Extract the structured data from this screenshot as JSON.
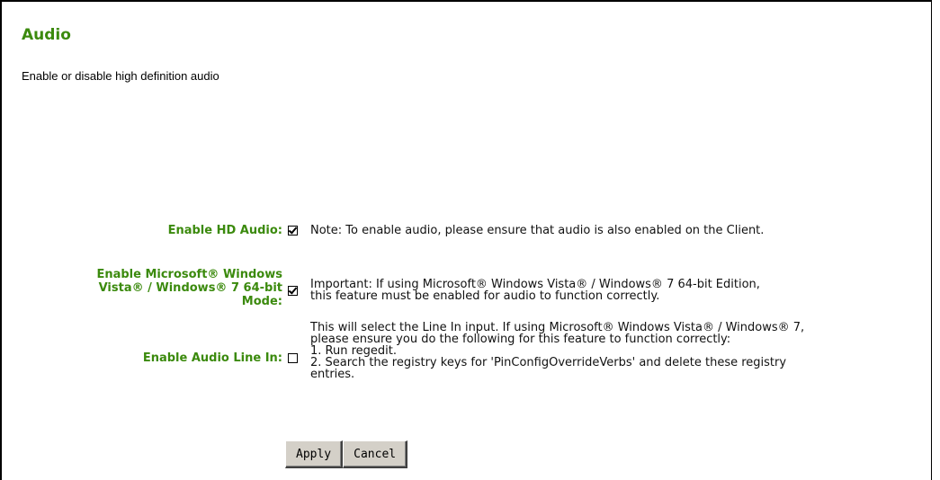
{
  "page": {
    "title": "Audio",
    "description": "Enable or disable high definition audio"
  },
  "settings": {
    "hd_audio": {
      "label": "Enable HD Audio:",
      "checked": true,
      "note": "Note: To enable audio, please ensure that audio is also enabled on the Client."
    },
    "ms_vista_mode": {
      "label_lines": [
        "Enable Microsoft® Windows",
        "Vista® / Windows® 7 64-bit",
        "Mode:"
      ],
      "checked": true,
      "note_lines": [
        "Important: If using Microsoft® Windows Vista® / Windows® 7 64-bit Edition,",
        "this feature must be enabled for audio to function correctly."
      ]
    },
    "line_in": {
      "label": "Enable Audio Line In:",
      "checked": false,
      "note_lines": [
        "This will select the Line In input. If using Microsoft® Windows Vista® / Windows® 7,",
        "please ensure you do the following for this feature to function correctly:",
        "1. Run regedit.",
        "2. Search the registry keys for 'PinConfigOverrideVerbs' and delete these registry",
        "entries."
      ]
    }
  },
  "buttons": {
    "apply": "Apply",
    "cancel": "Cancel"
  }
}
